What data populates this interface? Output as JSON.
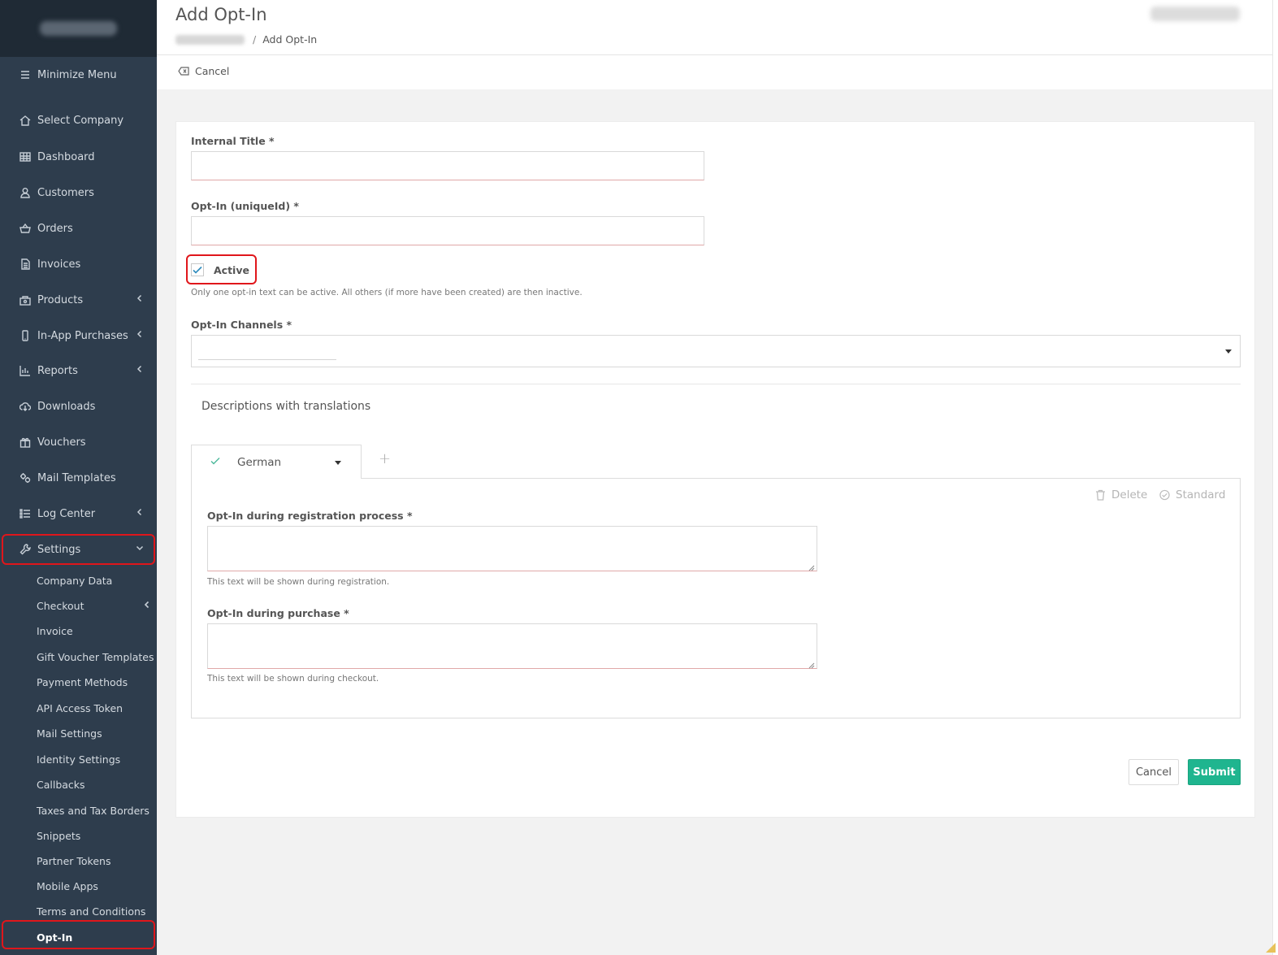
{
  "sidebar": {
    "minimize_label": "Minimize Menu",
    "items": [
      {
        "label": "Select Company",
        "icon": "home-icon"
      },
      {
        "label": "Dashboard",
        "icon": "table-icon"
      },
      {
        "label": "Customers",
        "icon": "user-icon"
      },
      {
        "label": "Orders",
        "icon": "basket-icon"
      },
      {
        "label": "Invoices",
        "icon": "document-icon"
      },
      {
        "label": "Products",
        "icon": "products-icon"
      },
      {
        "label": "In-App Purchases",
        "icon": "mobile-icon"
      },
      {
        "label": "Reports",
        "icon": "chart-icon"
      },
      {
        "label": "Downloads",
        "icon": "download-icon"
      },
      {
        "label": "Vouchers",
        "icon": "gift-icon"
      },
      {
        "label": "Mail Templates",
        "icon": "gears-icon"
      },
      {
        "label": "Log Center",
        "icon": "list-icon"
      },
      {
        "label": "Settings",
        "icon": "wrench-icon"
      }
    ],
    "settings_subitems": [
      "Company Data",
      "Checkout",
      "Invoice",
      "Gift Voucher Templates",
      "Payment Methods",
      "API Access Token",
      "Mail Settings",
      "Identity Settings",
      "Callbacks",
      "Taxes and Tax Borders",
      "Snippets",
      "Partner Tokens",
      "Mobile Apps",
      "Terms and Conditions",
      "Opt-In"
    ],
    "active_subitem": "Opt-In",
    "highlight_color": "#e0161b"
  },
  "header": {
    "title": "Add Opt-In",
    "breadcrumb_sep": "/",
    "breadcrumb_current": "Add Opt-In",
    "cancel_label": "Cancel"
  },
  "form": {
    "internal_title_label": "Internal Title *",
    "internal_title_value": "",
    "optin_uniqueid_label": "Opt-In (uniqueId) *",
    "optin_uniqueid_value": "",
    "active_label": "Active",
    "active_checked": true,
    "active_help": "Only one opt-in text can be active. All others (if more have been created) are then inactive.",
    "channels_label": "Opt-In Channels *",
    "channels_value": "",
    "descriptions_title": "Descriptions with translations",
    "tab_language": "German",
    "tab_add": "+",
    "delete_label": "Delete",
    "standard_label": "Standard",
    "registration_label": "Opt-In during registration process *",
    "registration_value": "",
    "registration_help": "This text will be shown during registration.",
    "purchase_label": "Opt-In during purchase *",
    "purchase_value": "",
    "purchase_help": "This text will be shown during checkout.",
    "cancel_button": "Cancel",
    "submit_button": "Submit"
  },
  "colors": {
    "sidebar_bg": "#2e3d4d",
    "submit_bg": "#1fb58f",
    "checkbox_check": "#2e8bbd"
  }
}
